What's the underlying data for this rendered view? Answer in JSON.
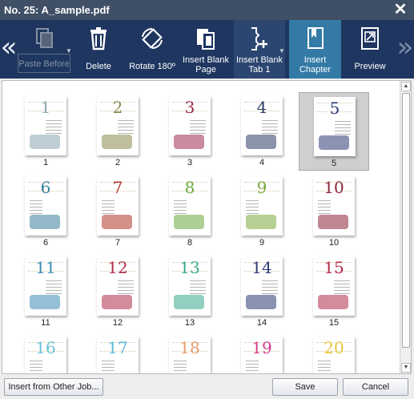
{
  "window": {
    "title": "No. 25: A_sample.pdf",
    "close_glyph": "✕"
  },
  "toolbar": {
    "left_arrow": "«",
    "right_arrow": "»",
    "buttons": [
      {
        "label": "Paste Before",
        "icon": "paste-icon",
        "state": "disabled"
      },
      {
        "label": "Delete",
        "icon": "trash-icon",
        "state": "normal"
      },
      {
        "label": "Rotate 180º",
        "icon": "rotate-icon",
        "state": "normal"
      },
      {
        "label": "Insert Blank Page",
        "icon": "insert-blank-page-icon",
        "state": "normal"
      },
      {
        "label": "Insert Blank Tab 1",
        "icon": "insert-tab-icon",
        "state": "normal"
      },
      {
        "label": "Insert Chapter",
        "icon": "bookmark-icon",
        "state": "active"
      },
      {
        "label": "Preview",
        "icon": "preview-icon",
        "state": "normal"
      }
    ]
  },
  "pages": [
    {
      "num": "1",
      "label": "1",
      "color": "#8aa6b0"
    },
    {
      "num": "2",
      "label": "2",
      "color": "#8a8a4a"
    },
    {
      "num": "3",
      "label": "3",
      "color": "#9c2c4c"
    },
    {
      "num": "4",
      "label": "4",
      "color": "#2c3a64"
    },
    {
      "num": "5",
      "label": "5",
      "color": "#2c3a74",
      "selected": true
    },
    {
      "num": "6",
      "label": "6",
      "color": "#3a7f9c"
    },
    {
      "num": "7",
      "label": "7",
      "color": "#b03428"
    },
    {
      "num": "8",
      "label": "8",
      "color": "#6aa83a"
    },
    {
      "num": "9",
      "label": "9",
      "color": "#7aa83a"
    },
    {
      "num": "10",
      "label": "10",
      "color": "#8c2438"
    },
    {
      "num": "11",
      "label": "11",
      "color": "#3a8cb4"
    },
    {
      "num": "12",
      "label": "12",
      "color": "#b02c48"
    },
    {
      "num": "13",
      "label": "13",
      "color": "#3aa88c"
    },
    {
      "num": "14",
      "label": "14",
      "color": "#2c3a74"
    },
    {
      "num": "15",
      "label": "15",
      "color": "#b02c48"
    },
    {
      "num": "16",
      "label": "16",
      "color": "#6ac0d8"
    },
    {
      "num": "17",
      "label": "17",
      "color": "#5ab8d8"
    },
    {
      "num": "18",
      "label": "18",
      "color": "#e89a6a"
    },
    {
      "num": "19",
      "label": "19",
      "color": "#d43c8c"
    },
    {
      "num": "20",
      "label": "20",
      "color": "#e8c83a"
    }
  ],
  "footer": {
    "insert_other_label": "Insert from Other Job...",
    "save_label": "Save",
    "cancel_label": "Cancel"
  }
}
